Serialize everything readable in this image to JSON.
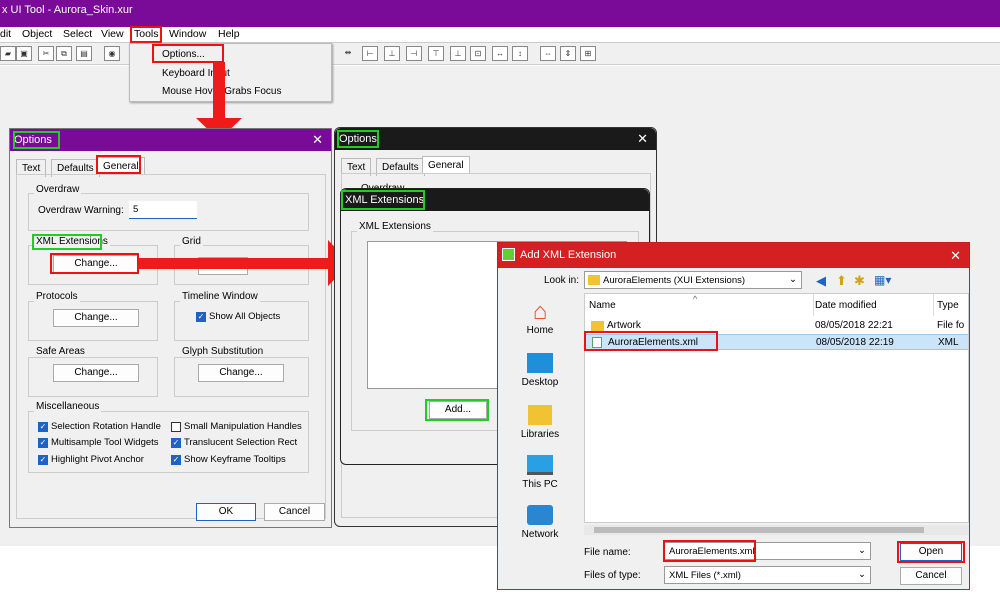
{
  "app": {
    "title": "x UI Tool - Aurora_Skin.xur"
  },
  "menu": {
    "edit": "dit",
    "object": "Object",
    "select": "Select",
    "view": "View",
    "tools": "Tools",
    "window": "Window",
    "help": "Help"
  },
  "tools_menu": {
    "options": "Options...",
    "keyboard": "Keyboard Input",
    "mouse": "Mouse Hover Grabs Focus"
  },
  "options": {
    "title": "Options",
    "tabs": [
      "Text",
      "Defaults",
      "General"
    ],
    "overdraw_group": "Overdraw",
    "overdraw_label": "Overdraw Warning:",
    "overdraw_value": "5",
    "xml_group": "XML Extensions",
    "change": "Change...",
    "grid_group": "Grid",
    "protocols_group": "Protocols",
    "timeline_group": "Timeline Window",
    "show_all_objects": "Show All Objects",
    "safe_group": "Safe Areas",
    "glyph_group": "Glyph Substitution",
    "misc_group": "Miscellaneous",
    "misc": {
      "c1": "Selection Rotation Handle",
      "c2": "Small Manipulation Handles",
      "c3": "Multisample Tool Widgets",
      "c4": "Translucent Selection Rect",
      "c5": "Highlight Pivot Anchor",
      "c6": "Show Keyframe Tooltips"
    },
    "ok": "OK",
    "cancel": "Cancel"
  },
  "options2": {
    "title": "Options",
    "tabs": [
      "Text",
      "Defaults",
      "General"
    ],
    "overdraw": "Overdraw"
  },
  "xmlext": {
    "title": "XML Extensions",
    "group": "XML Extensions",
    "add": "Add..."
  },
  "addxml": {
    "title": "Add XML Extension",
    "look_in_label": "Look in:",
    "look_in_value": "AuroraElements (XUI Extensions)",
    "sidebar": [
      "Home",
      "Desktop",
      "Libraries",
      "This PC",
      "Network"
    ],
    "col_name": "Name",
    "col_date": "Date modified",
    "col_type": "Type",
    "rows": [
      {
        "name": "Artwork",
        "date": "08/05/2018 22:21",
        "type": "File fo"
      },
      {
        "name": "AuroraElements.xml",
        "date": "08/05/2018 22:19",
        "type": "XML"
      }
    ],
    "filename_label": "File name:",
    "filename_value": "AuroraElements.xml",
    "filetype_label": "Files of type:",
    "filetype_value": "XML Files (*.xml)",
    "open": "Open",
    "cancel": "Cancel"
  }
}
